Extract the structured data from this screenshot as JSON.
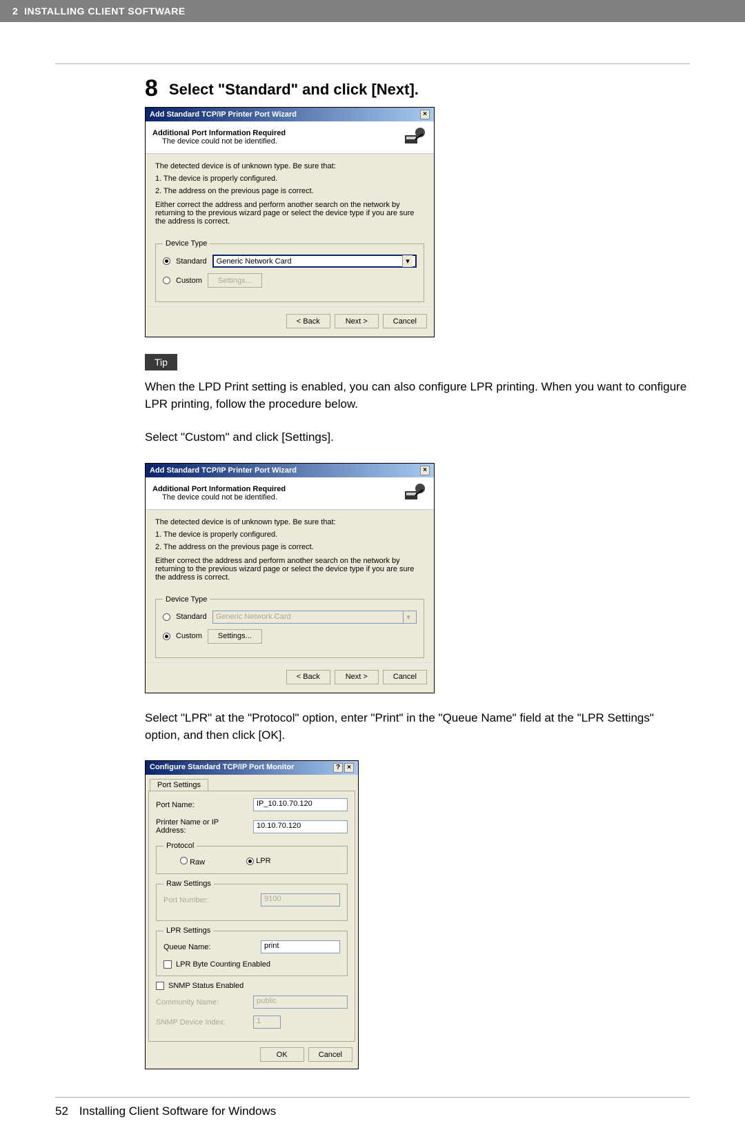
{
  "header": {
    "chapter_num": "2",
    "chapter_title": "INSTALLING CLIENT SOFTWARE"
  },
  "step": {
    "number": "8",
    "title": "Select \"Standard\" and click [Next]."
  },
  "wizard1": {
    "title": "Add Standard TCP/IP Printer Port Wizard",
    "hdr_bold": "Additional Port Information Required",
    "hdr_sub": "The device could not be identified.",
    "line1": "The detected device is of unknown type.  Be sure that:",
    "line2": "1.  The device is properly configured.",
    "line3": "2.  The address on the previous page is correct.",
    "line4": "Either correct the address and perform another search on the network by returning to the previous wizard page or select the device type if you are sure the address is correct.",
    "legend": "Device Type",
    "radio_standard": "Standard",
    "combo_standard": "Generic Network Card",
    "radio_custom": "Custom",
    "btn_settings": "Settings...",
    "btn_back": "< Back",
    "btn_next": "Next >",
    "btn_cancel": "Cancel"
  },
  "tip_label": "Tip",
  "tip_text": "When the LPD Print setting is enabled, you can also configure LPR printing. When you want to configure LPR printing, follow the procedure below.",
  "custom_instr": "Select \"Custom\" and click [Settings].",
  "wizard2": {
    "title": "Add Standard TCP/IP Printer Port Wizard",
    "hdr_bold": "Additional Port Information Required",
    "hdr_sub": "The device could not be identified.",
    "line1": "The detected device is of unknown type.  Be sure that:",
    "line2": "1.  The device is properly configured.",
    "line3": "2.  The address on the previous page is correct.",
    "line4": "Either correct the address and perform another search on the network by returning to the previous wizard page or select the device type if you are sure the address is correct.",
    "legend": "Device Type",
    "radio_standard": "Standard",
    "combo_standard": "Generic Network Card",
    "radio_custom": "Custom",
    "btn_settings": "Settings...",
    "btn_back": "< Back",
    "btn_next": "Next >",
    "btn_cancel": "Cancel"
  },
  "lpr_instr": "Select \"LPR\" at the \"Protocol\" option, enter \"Print\" in the \"Queue Name\" field at the \"LPR Settings\" option, and then click [OK].",
  "portmon": {
    "title": "Configure Standard TCP/IP Port Monitor",
    "tab": "Port Settings",
    "port_name_label": "Port Name:",
    "port_name": "IP_10.10.70.120",
    "printer_label": "Printer Name or IP Address:",
    "printer_ip": "10.10.70.120",
    "protocol_legend": "Protocol",
    "proto_raw": "Raw",
    "proto_lpr": "LPR",
    "raw_legend": "Raw Settings",
    "raw_port_label": "Port Number:",
    "raw_port": "9100",
    "lpr_legend": "LPR Settings",
    "queue_label": "Queue Name:",
    "queue_value": "print",
    "lpr_byte": "LPR Byte Counting Enabled",
    "snmp_enabled": "SNMP Status Enabled",
    "community_label": "Community Name:",
    "community_value": "public",
    "snmp_idx_label": "SNMP Device Index:",
    "snmp_idx_value": "1",
    "btn_ok": "OK",
    "btn_cancel": "Cancel"
  },
  "footer": {
    "page": "52",
    "section": "Installing Client Software for Windows"
  }
}
